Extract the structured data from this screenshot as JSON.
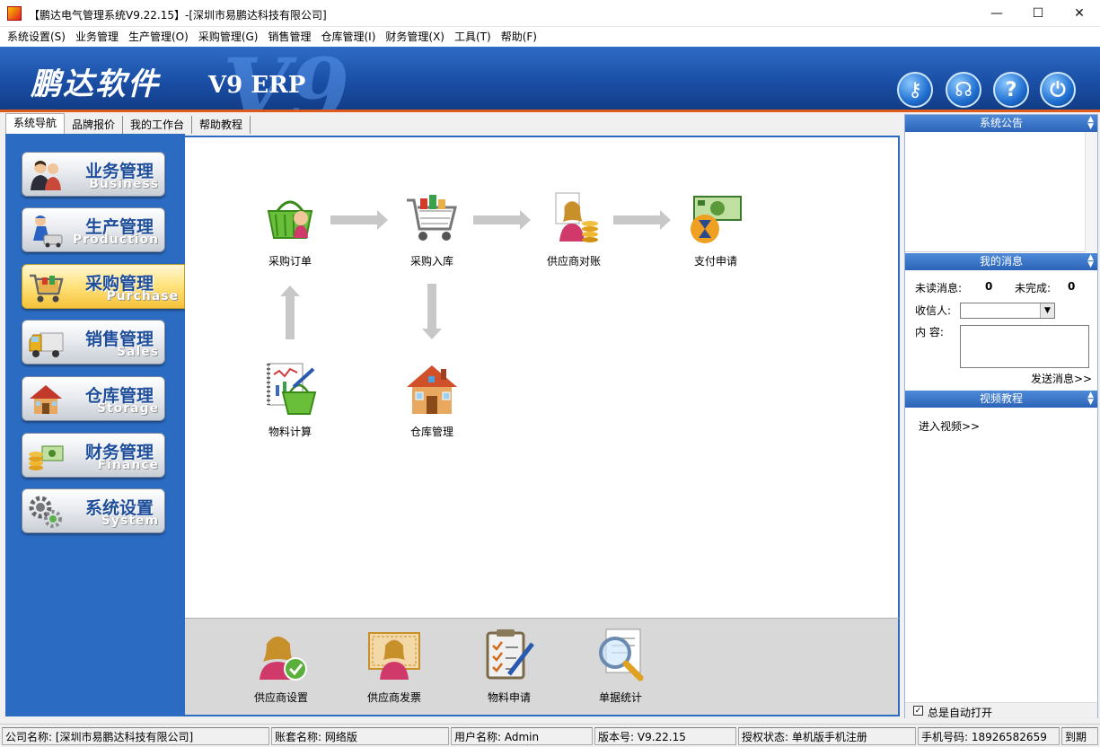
{
  "window": {
    "title": "【鹏达电气管理系统V9.22.15】-[深圳市易鹏达科技有限公司]",
    "min": "—",
    "max": "☐",
    "close": "✕"
  },
  "menu": [
    "系统设置(S)",
    "业务管理",
    "生产管理(O)",
    "采购管理(G)",
    "销售管理",
    "仓库管理(I)",
    "财务管理(X)",
    "工具(T)",
    "帮助(F)"
  ],
  "banner": {
    "logo": "鹏达软件",
    "watermark": "V9",
    "product": "V9 ERP",
    "help_glyph": "?",
    "power_glyph": "⏻",
    "key_glyph": "⚷",
    "support_glyph": "☊"
  },
  "tabs": [
    "系统导航",
    "品牌报价",
    "我的工作台",
    "帮助教程"
  ],
  "sidebar": [
    {
      "cn": "业务管理",
      "en": "Business"
    },
    {
      "cn": "生产管理",
      "en": "Production"
    },
    {
      "cn": "采购管理",
      "en": "Purchase"
    },
    {
      "cn": "销售管理",
      "en": "Sales"
    },
    {
      "cn": "仓库管理",
      "en": "Storage"
    },
    {
      "cn": "财务管理",
      "en": "Finance"
    },
    {
      "cn": "系统设置",
      "en": "System"
    }
  ],
  "flow": {
    "purchase_order": "采购订单",
    "purchase_inbound": "采购入库",
    "supplier_reconcile": "供应商对账",
    "payment_request": "支付申请",
    "material_calc": "物料计算",
    "warehouse": "仓库管理"
  },
  "bottom_tools": [
    "供应商设置",
    "供应商发票",
    "物料申请",
    "单据统计"
  ],
  "right_panel": {
    "notice_title": "系统公告",
    "messages_title": "我的消息",
    "unread_label": "未读消息:",
    "unread_count": "0",
    "unfinished_label": "未完成:",
    "unfinished_count": "0",
    "recipient_label": "收信人:",
    "content_label": "内  容:",
    "send_link": "发送消息>>",
    "video_title": "视频教程",
    "video_link": "进入视频>>",
    "auto_open_label": "总是自动打开",
    "auto_open_checked": "✓"
  },
  "status": {
    "company": "公司名称: [深圳市易鹏达科技有限公司]",
    "account": "账套名称: 网络版",
    "user": "用户名称: Admin",
    "version": "版本号: V9.22.15",
    "license": "授权状态: 单机版手机注册",
    "phone": "手机号码: 18926582659",
    "extra": "到期"
  }
}
